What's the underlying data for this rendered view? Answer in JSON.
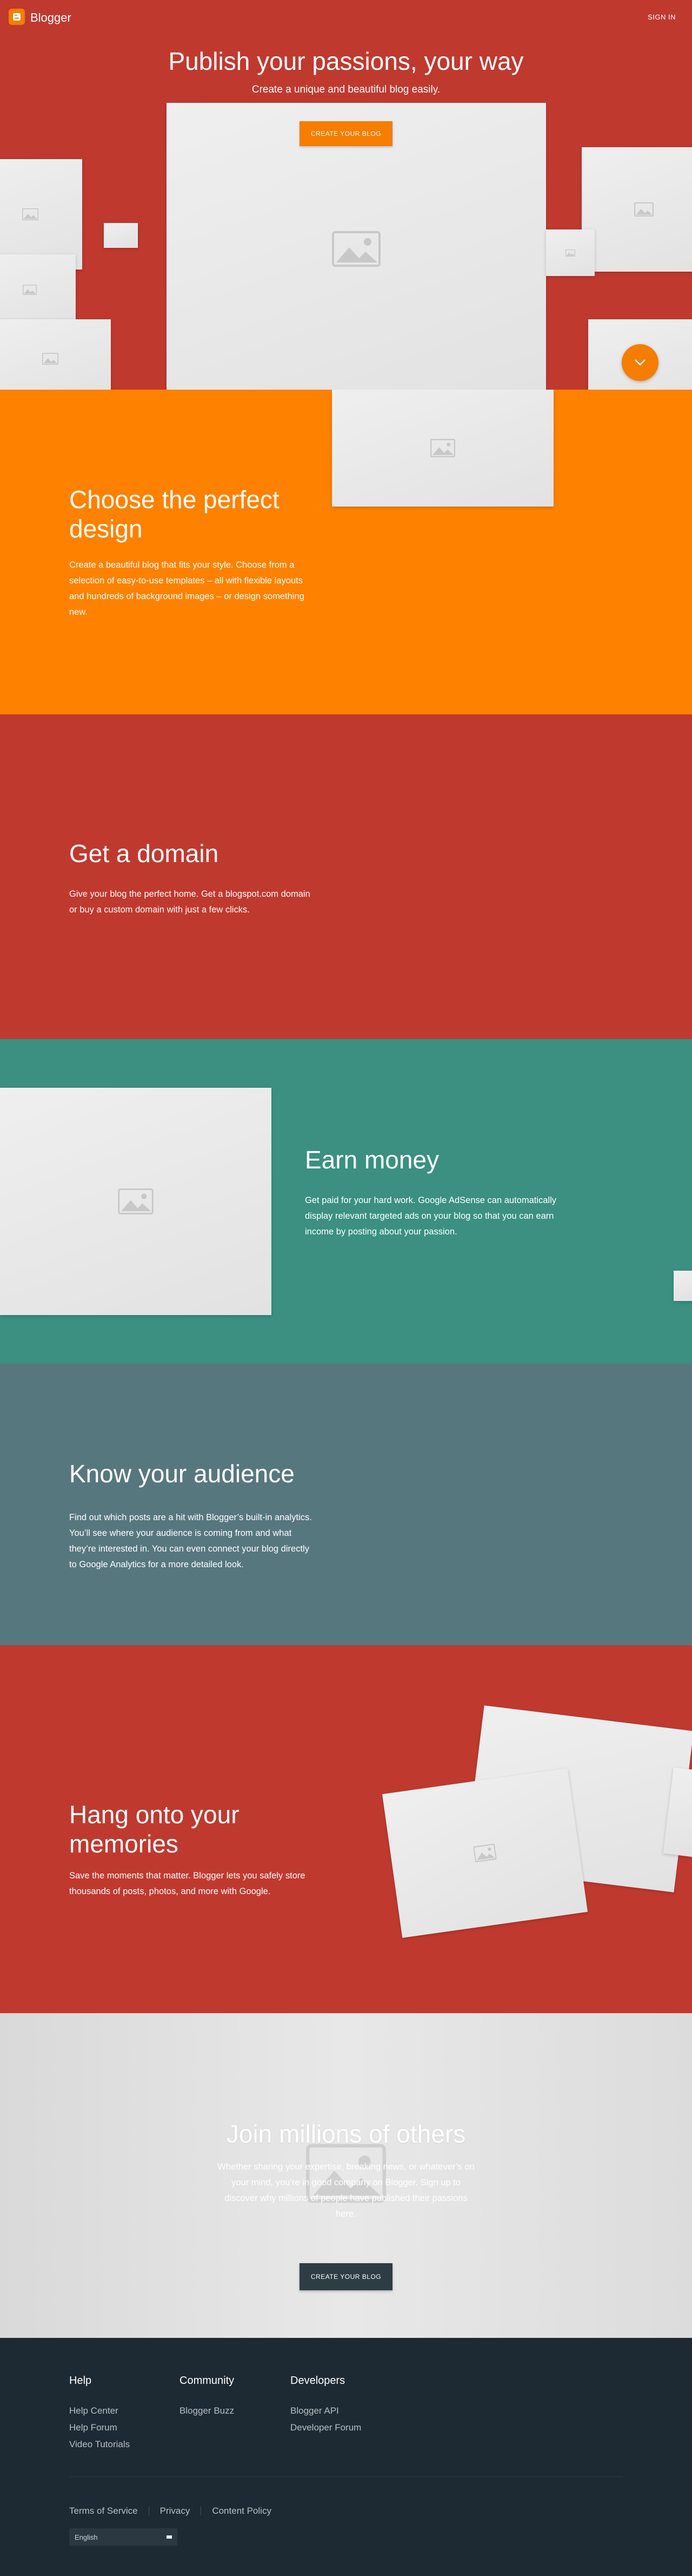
{
  "header": {
    "brand": "Blogger",
    "sign_in": "SIGN IN"
  },
  "hero": {
    "title": "Publish your passions, your way",
    "subtitle": "Create a unique and beautiful blog easily.",
    "cta": "CREATE YOUR BLOG",
    "scroll_icon": "chevron-down-icon"
  },
  "sections": {
    "design": {
      "title": "Choose the perfect design",
      "text": "Create a beautiful blog that fits your style. Choose from a selection of easy-to-use templates – all with flexible layouts and hundreds of background images – or design something new."
    },
    "domain": {
      "title": "Get a domain",
      "text": "Give your blog the perfect home. Get a blogspot.com domain or buy a custom domain with just a few clicks."
    },
    "money": {
      "title": "Earn money",
      "text": "Get paid for your hard work. Google AdSense can automatically display relevant targeted ads on your blog so that you can earn income by posting about your passion."
    },
    "audience": {
      "title": "Know your audience",
      "text": "Find out which posts are a hit with Blogger’s built-in analytics. You’ll see where your audience is coming from and what they’re interested in. You can even connect your blog directly to Google Analytics for a more detailed look."
    },
    "memories": {
      "title": "Hang onto your memories",
      "text": "Save the moments that matter. Blogger lets you safely store thousands of posts, photos, and more with Google."
    },
    "join": {
      "title": "Join millions of others",
      "text": "Whether sharing your expertise, breaking news, or whatever’s on your mind, you’re in good company on Blogger. Sign up to discover why millions of people have published their passions here.",
      "cta": "CREATE YOUR BLOG"
    }
  },
  "footer": {
    "columns": [
      {
        "title": "Help",
        "links": [
          "Help Center",
          "Help Forum",
          "Video Tutorials"
        ]
      },
      {
        "title": "Community",
        "links": [
          "Blogger Buzz"
        ]
      },
      {
        "title": "Developers",
        "links": [
          "Blogger API",
          "Developer Forum"
        ]
      }
    ],
    "bottom_links": [
      "Terms of Service",
      "Privacy",
      "Content Policy"
    ],
    "language": "English"
  },
  "colors": {
    "brand_orange": "#f57d00",
    "red": "#c0392f",
    "orange_section": "#ff8100",
    "teal": "#3b9082",
    "slate": "#57777f",
    "footer": "#1e2a33"
  }
}
